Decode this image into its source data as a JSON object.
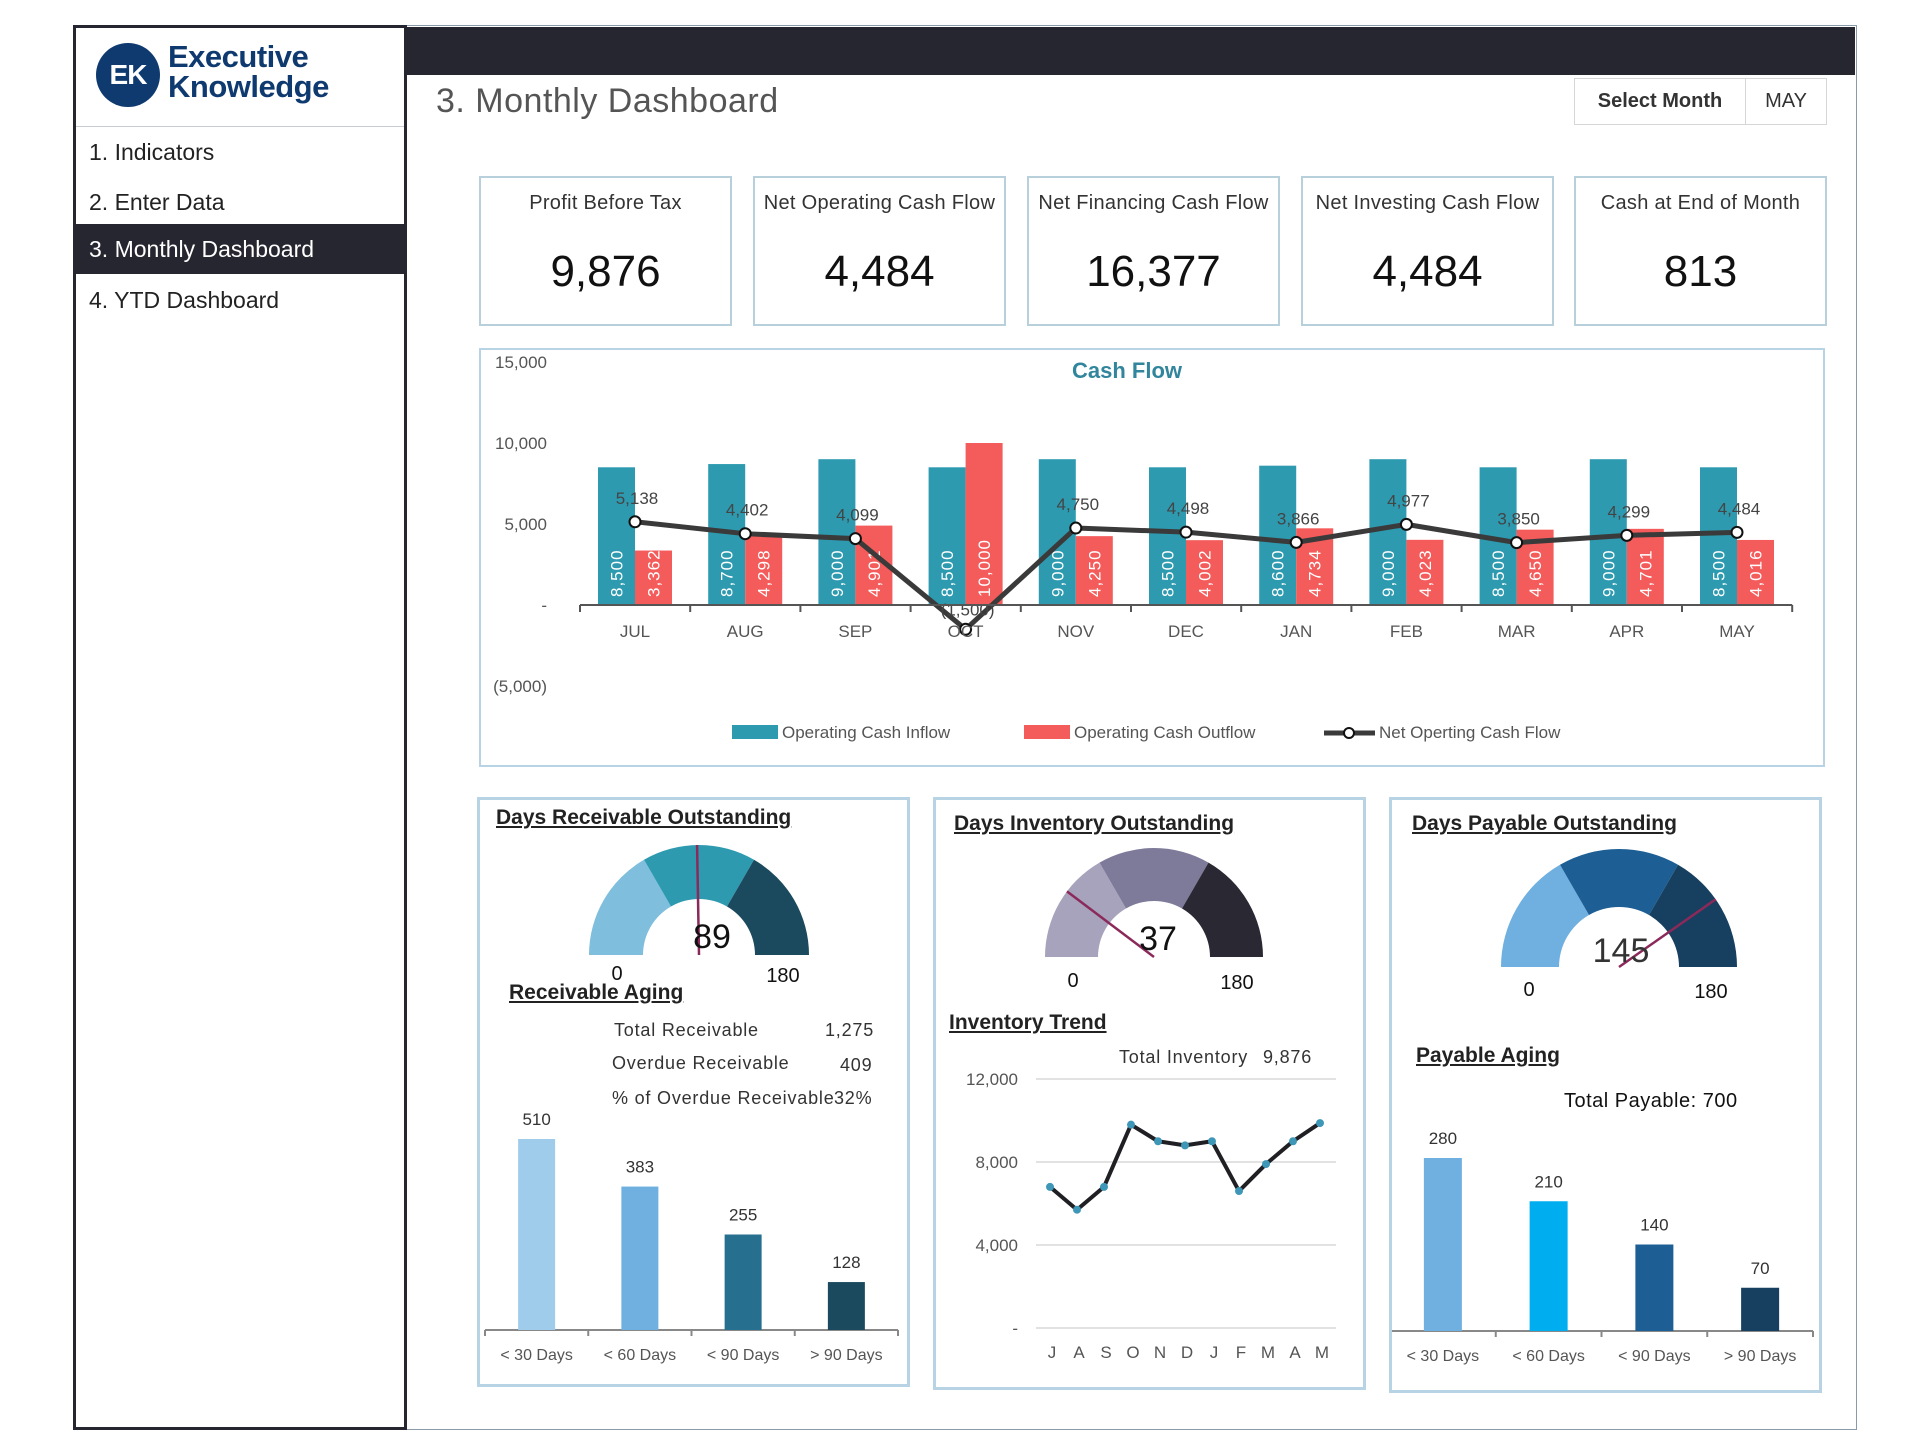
{
  "brand": {
    "initials": "EK",
    "line1": "Executive",
    "line2": "Knowledge"
  },
  "sidebar": {
    "items": [
      {
        "label": "1. Indicators",
        "active": false
      },
      {
        "label": "2. Enter Data",
        "active": false
      },
      {
        "label": "3. Monthly Dashboard",
        "active": true
      },
      {
        "label": "4. YTD Dashboard",
        "active": false
      }
    ]
  },
  "header": {
    "title": "3. Monthly Dashboard",
    "select_month_label": "Select Month",
    "select_month_value": "MAY"
  },
  "kpis": [
    {
      "label": "Profit Before Tax",
      "value": "9,876"
    },
    {
      "label": "Net Operating Cash Flow",
      "value": "4,484"
    },
    {
      "label": "Net Financing Cash Flow",
      "value": "16,377"
    },
    {
      "label": "Net Investing Cash Flow",
      "value": "4,484"
    },
    {
      "label": "Cash at End of Month",
      "value": "813"
    }
  ],
  "colors": {
    "inflow": "#2E9AB0",
    "outflow": "#F45B5B",
    "net_line": "#3a3a3a",
    "title_teal": "#31859C",
    "needle": "#8B2A5A"
  },
  "chart_data": [
    {
      "type": "bar",
      "title": "Cash Flow",
      "categories": [
        "JUL",
        "AUG",
        "SEP",
        "OCT",
        "NOV",
        "DEC",
        "JAN",
        "FEB",
        "MAR",
        "APR",
        "MAY"
      ],
      "series": [
        {
          "name": "Operating Cash Inflow",
          "kind": "bar",
          "values": [
            8500,
            8700,
            9000,
            8500,
            9000,
            8500,
            8600,
            9000,
            8500,
            9000,
            8500
          ],
          "labels": [
            "8,500",
            "8,700",
            "9,000",
            "8,500",
            "9,000",
            "8,500",
            "8,600",
            "9,000",
            "8,500",
            "9,000",
            "8,500"
          ]
        },
        {
          "name": "Operating Cash Outflow",
          "kind": "bar",
          "values": [
            3362,
            4298,
            4901,
            10000,
            4250,
            4002,
            4734,
            4023,
            4650,
            4701,
            4016
          ],
          "labels": [
            "3,362",
            "4,298",
            "4,901",
            "10,000",
            "4,250",
            "4,002",
            "4,734",
            "4,023",
            "4,650",
            "4,701",
            "4,016"
          ]
        },
        {
          "name": "Net Operting Cash Flow",
          "kind": "line",
          "values": [
            5138,
            4402,
            4099,
            -1500,
            4750,
            4498,
            3866,
            4977,
            3850,
            4299,
            4484
          ],
          "labels": [
            "5,138",
            "4,402",
            "4,099",
            "(1,500)",
            "4,750",
            "4,498",
            "3,866",
            "4,977",
            "3,850",
            "4,299",
            "4,484"
          ]
        }
      ],
      "yticks": [
        15000,
        10000,
        5000,
        0,
        -5000
      ],
      "ytick_labels": [
        "15,000",
        "10,000",
        "5,000",
        "-",
        "(5,000)"
      ],
      "ylim": [
        -5000,
        15000
      ],
      "legend": "bottom",
      "xlabel": "",
      "ylabel": ""
    },
    {
      "type": "gauge",
      "title": "Days Receivable Outstanding",
      "value": 89,
      "min": 0,
      "max": 180,
      "min_label": "0",
      "max_label": "180",
      "bands": [
        {
          "from": 0,
          "to": 60,
          "color": "#7FBEDC"
        },
        {
          "from": 60,
          "to": 120,
          "color": "#2E9AB0"
        },
        {
          "from": 120,
          "to": 180,
          "color": "#1B4A5E"
        }
      ]
    },
    {
      "type": "bar",
      "title": "Receivable Aging",
      "categories": [
        "< 30 Days",
        "< 60 Days",
        "< 90 Days",
        "> 90 Days"
      ],
      "values": [
        510,
        383,
        255,
        128
      ],
      "value_labels": [
        "510",
        "383",
        "255",
        "128"
      ],
      "colors": [
        "#9FCCEB",
        "#6FB0E0",
        "#276F8E",
        "#1B4A5E"
      ],
      "ylim": [
        0,
        510
      ]
    },
    {
      "type": "gauge",
      "title": "Days Inventory Outstanding",
      "value": 37,
      "min": 0,
      "max": 180,
      "min_label": "0",
      "max_label": "180",
      "bands": [
        {
          "from": 0,
          "to": 60,
          "color": "#A7A3BC"
        },
        {
          "from": 60,
          "to": 120,
          "color": "#7E7A9A"
        },
        {
          "from": 120,
          "to": 180,
          "color": "#292833"
        }
      ]
    },
    {
      "type": "line",
      "title": "Inventory Trend",
      "x": [
        "J",
        "A",
        "S",
        "O",
        "N",
        "D",
        "J",
        "F",
        "M",
        "A",
        "M"
      ],
      "values": [
        6800,
        5700,
        6800,
        9800,
        9000,
        8800,
        9000,
        6600,
        7900,
        9000,
        9876
      ],
      "yticks": [
        12000,
        8000,
        4000,
        0
      ],
      "ytick_labels": [
        "12,000",
        "8,000",
        "4,000",
        "-"
      ],
      "ylim": [
        0,
        12000
      ],
      "grid": true
    },
    {
      "type": "gauge",
      "title": "Days Payable Outstanding",
      "value": 145,
      "min": 0,
      "max": 180,
      "min_label": "0",
      "max_label": "180",
      "bands": [
        {
          "from": 0,
          "to": 60,
          "color": "#6FB0E0"
        },
        {
          "from": 60,
          "to": 120,
          "color": "#1D5F95"
        },
        {
          "from": 120,
          "to": 180,
          "color": "#173F5F"
        }
      ]
    },
    {
      "type": "bar",
      "title": "Payable Aging",
      "categories": [
        "< 30 Days",
        "< 60 Days",
        "< 90 Days",
        "> 90 Days"
      ],
      "values": [
        280,
        210,
        140,
        70
      ],
      "value_labels": [
        "280",
        "210",
        "140",
        "70"
      ],
      "colors": [
        "#6FB0E0",
        "#00AEEF",
        "#1D5F95",
        "#173F5F"
      ],
      "ylim": [
        0,
        280
      ]
    }
  ],
  "receivable": {
    "section_title": "Receivable Aging",
    "rows": [
      {
        "label": "Total Receivable",
        "value": "1,275"
      },
      {
        "label": "Overdue Receivable",
        "value": "409"
      },
      {
        "label": "% of Overdue Receivable",
        "value": "32%"
      }
    ]
  },
  "inventory": {
    "section_title": "Inventory Trend",
    "total_label": "Total Inventory",
    "total_value": "9,876"
  },
  "payable": {
    "section_title": "Payable Aging",
    "total_text": "Total Payable: 700"
  }
}
